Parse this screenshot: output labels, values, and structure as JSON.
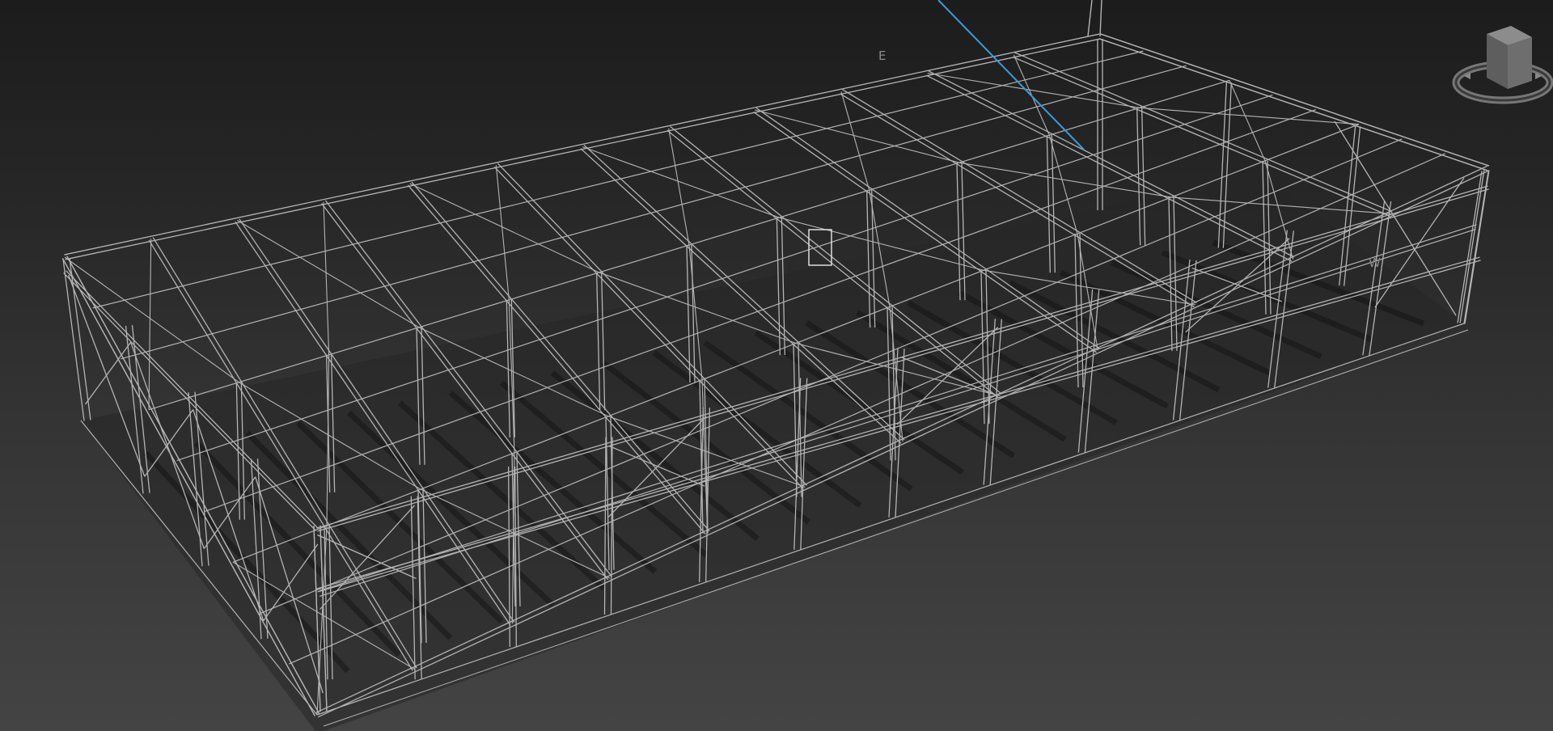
{
  "viewport": {
    "compass": {
      "east_label": "E",
      "west_label": "W"
    },
    "viewcube": {
      "icon": "viewcube-icon"
    }
  },
  "colors": {
    "background_top": "#1c1c1c",
    "background_bottom": "#444444",
    "wireframe": "#b4b4b4",
    "axis_line": "#3d9ad6",
    "shadow": "#151515"
  }
}
